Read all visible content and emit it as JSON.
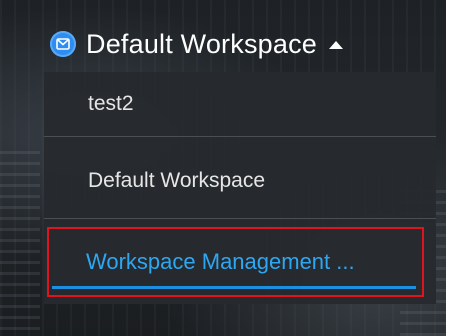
{
  "workspace_menu": {
    "current_workspace": "Default Workspace",
    "icon": "workspace-badge-icon",
    "toggle_icon": "chevron-up-icon",
    "items": [
      {
        "label": "test2"
      },
      {
        "label": "Default Workspace"
      },
      {
        "label": "Workspace Management ..."
      }
    ],
    "accent_color": "#2ea7f2",
    "highlight_color": "#e0141e"
  }
}
